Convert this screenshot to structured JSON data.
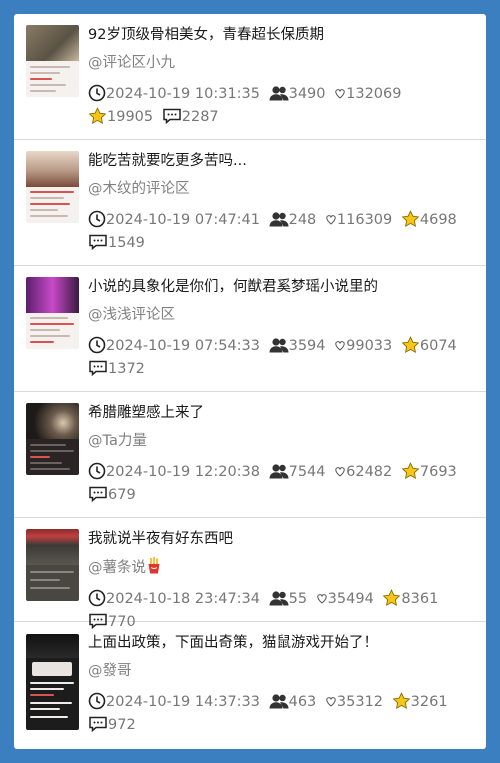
{
  "items": [
    {
      "title": "92岁顶级骨相美女，青春超长保质期",
      "author": "@评论区小九",
      "datetime": "2024-10-19 10:31:35",
      "fans": "3490",
      "likes": "132069",
      "favorites": "19905",
      "comments": "2287",
      "thumb_color": "#7a6f5c"
    },
    {
      "title": "能吃苦就要吃更多苦吗...",
      "author": "@木纹的评论区",
      "datetime": "2024-10-19 07:47:41",
      "fans": "248",
      "likes": "116309",
      "favorites": "4698",
      "comments": "1549",
      "thumb_color": "#b89a86"
    },
    {
      "title": "小说的具象化是你们，何猷君奚梦瑶小说里的",
      "author": "@浅浅评论区",
      "datetime": "2024-10-19 07:54:33",
      "fans": "3594",
      "likes": "99033",
      "favorites": "6074",
      "comments": "1372",
      "thumb_color": "#8a3a8f"
    },
    {
      "title": "希腊雕塑感上来了",
      "author": "@Ta力量",
      "datetime": "2024-10-19 12:20:38",
      "fans": "7544",
      "likes": "62482",
      "favorites": "7693",
      "comments": "679",
      "thumb_color": "#2a2320"
    },
    {
      "title": "我就说半夜有好东西吧",
      "author": "@薯条说",
      "author_emoji": "fries-icon",
      "datetime": "2024-10-18 23:47:34",
      "fans": "55",
      "likes": "35494",
      "favorites": "8361",
      "comments": "770",
      "thumb_color": "#3d3a36"
    },
    {
      "title": "上面出政策，下面出奇策，猫鼠游戏开始了！",
      "author": "@發哥",
      "datetime": "2024-10-19 14:37:33",
      "fans": "463",
      "likes": "35312",
      "favorites": "3261",
      "comments": "972",
      "thumb_color": "#1f1f1f"
    }
  ],
  "icons": {
    "time": "clock-icon",
    "fans": "fans-icon",
    "likes": "heart-icon",
    "favorites": "star-icon",
    "comments": "comment-icon"
  },
  "colors": {
    "background": "#3b7fc0",
    "star": "#f5c518",
    "text": "#1a1a1a",
    "muted": "#808080"
  }
}
